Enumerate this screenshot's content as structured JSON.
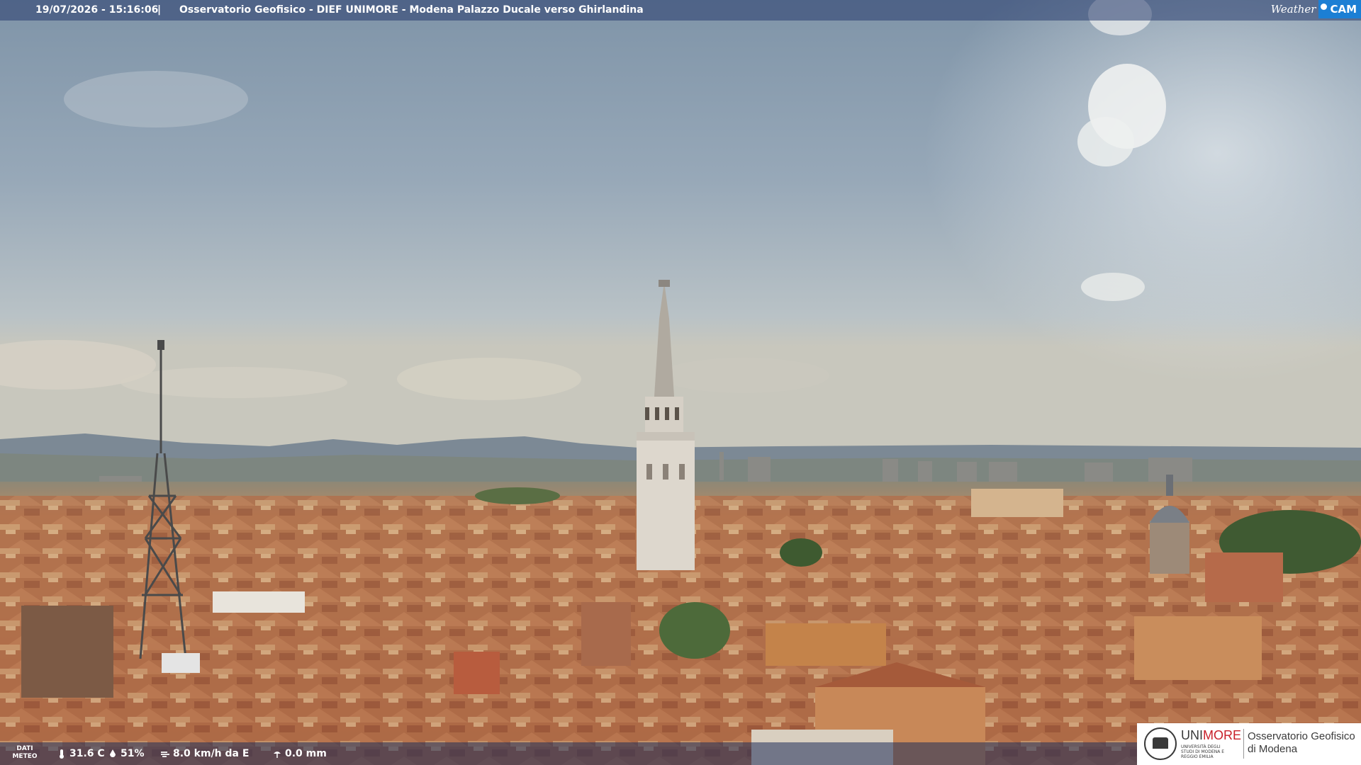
{
  "caption": {
    "timestamp": "19/07/2026 - 15:16:06",
    "separator": "|",
    "title": "Osservatorio Geofisico - DIEF UNIMORE - Modena Palazzo Ducale verso Ghirlandina"
  },
  "brand": {
    "weather": "Weather",
    "cam": "CAM"
  },
  "meteo": {
    "label_line1": "DATI",
    "label_line2": "METEO",
    "temperature": "31.6 C",
    "humidity": "51%",
    "wind": "8.0 km/h da E",
    "rain": "0.0 mm",
    "icons": [
      "thermometer-icon",
      "humidity-drop-icon",
      "wind-icon",
      "rain-icon"
    ]
  },
  "logo": {
    "uni_part1": "UNI",
    "uni_part2": "MORE",
    "subtitle": "UNIVERSITÀ DEGLI STUDI DI MODENA E REGGIO EMILIA",
    "observatory_line1": "Osservatorio Geofisico",
    "observatory_line2": "di Modena"
  },
  "colors": {
    "caption_bar": "#283c6e",
    "brand_blue": "#1c7fd4",
    "unimore_red": "#c8202a",
    "roof_terracotta": "#b8704a",
    "sky": "#9fb0c0"
  }
}
